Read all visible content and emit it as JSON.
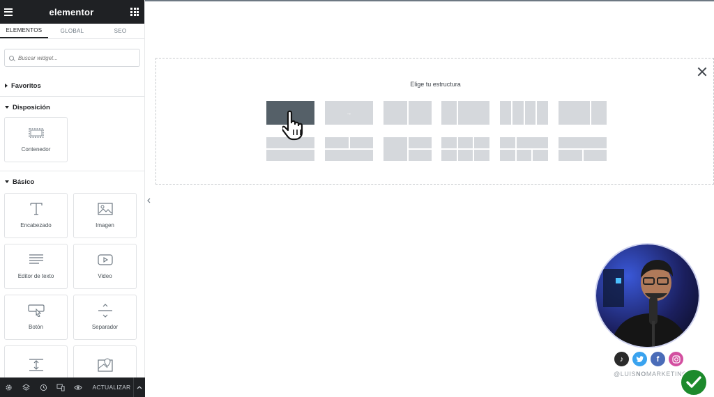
{
  "panel": {
    "logo": "elementor",
    "tabs": [
      {
        "label": "ELEMENTOS",
        "active": true
      },
      {
        "label": "GLOBAL",
        "active": false
      },
      {
        "label": "SEO",
        "active": false
      }
    ],
    "search_placeholder": "Buscar widget...",
    "categories": {
      "favoritos": "Favoritos",
      "disposicion": "Disposición",
      "basico": "Básico"
    },
    "layout_widgets": [
      {
        "label": "Contenedor",
        "icon": "container-icon"
      }
    ],
    "basic_widgets": [
      {
        "label": "Encabezado",
        "icon": "heading-icon"
      },
      {
        "label": "Imagen",
        "icon": "image-icon"
      },
      {
        "label": "Editor de texto",
        "icon": "text-editor-icon"
      },
      {
        "label": "Video",
        "icon": "video-icon"
      },
      {
        "label": "Botón",
        "icon": "button-icon"
      },
      {
        "label": "Separador",
        "icon": "divider-icon"
      },
      {
        "label": "",
        "icon": "spacer-icon"
      },
      {
        "label": "",
        "icon": "map-icon"
      }
    ],
    "footer": {
      "update_label": "ACTUALIZAR"
    }
  },
  "canvas": {
    "structure_title": "Elige tu estructura",
    "presets_row1": [
      "1",
      "2",
      "3",
      "4",
      "5",
      "6"
    ],
    "presets_row2": [
      "7",
      "8",
      "9",
      "10",
      "11",
      "12"
    ]
  },
  "overlay": {
    "social": [
      "tiktok",
      "twitter",
      "facebook",
      "instagram"
    ],
    "handle_prefix": "@LUIS",
    "handle_bold": "NO",
    "handle_suffix": "MARKETING"
  },
  "colors": {
    "panel_dark": "#1f2124",
    "preset_gray": "#d5d8dc",
    "preset_selected": "#556068",
    "check_green": "#1d8a2c"
  }
}
